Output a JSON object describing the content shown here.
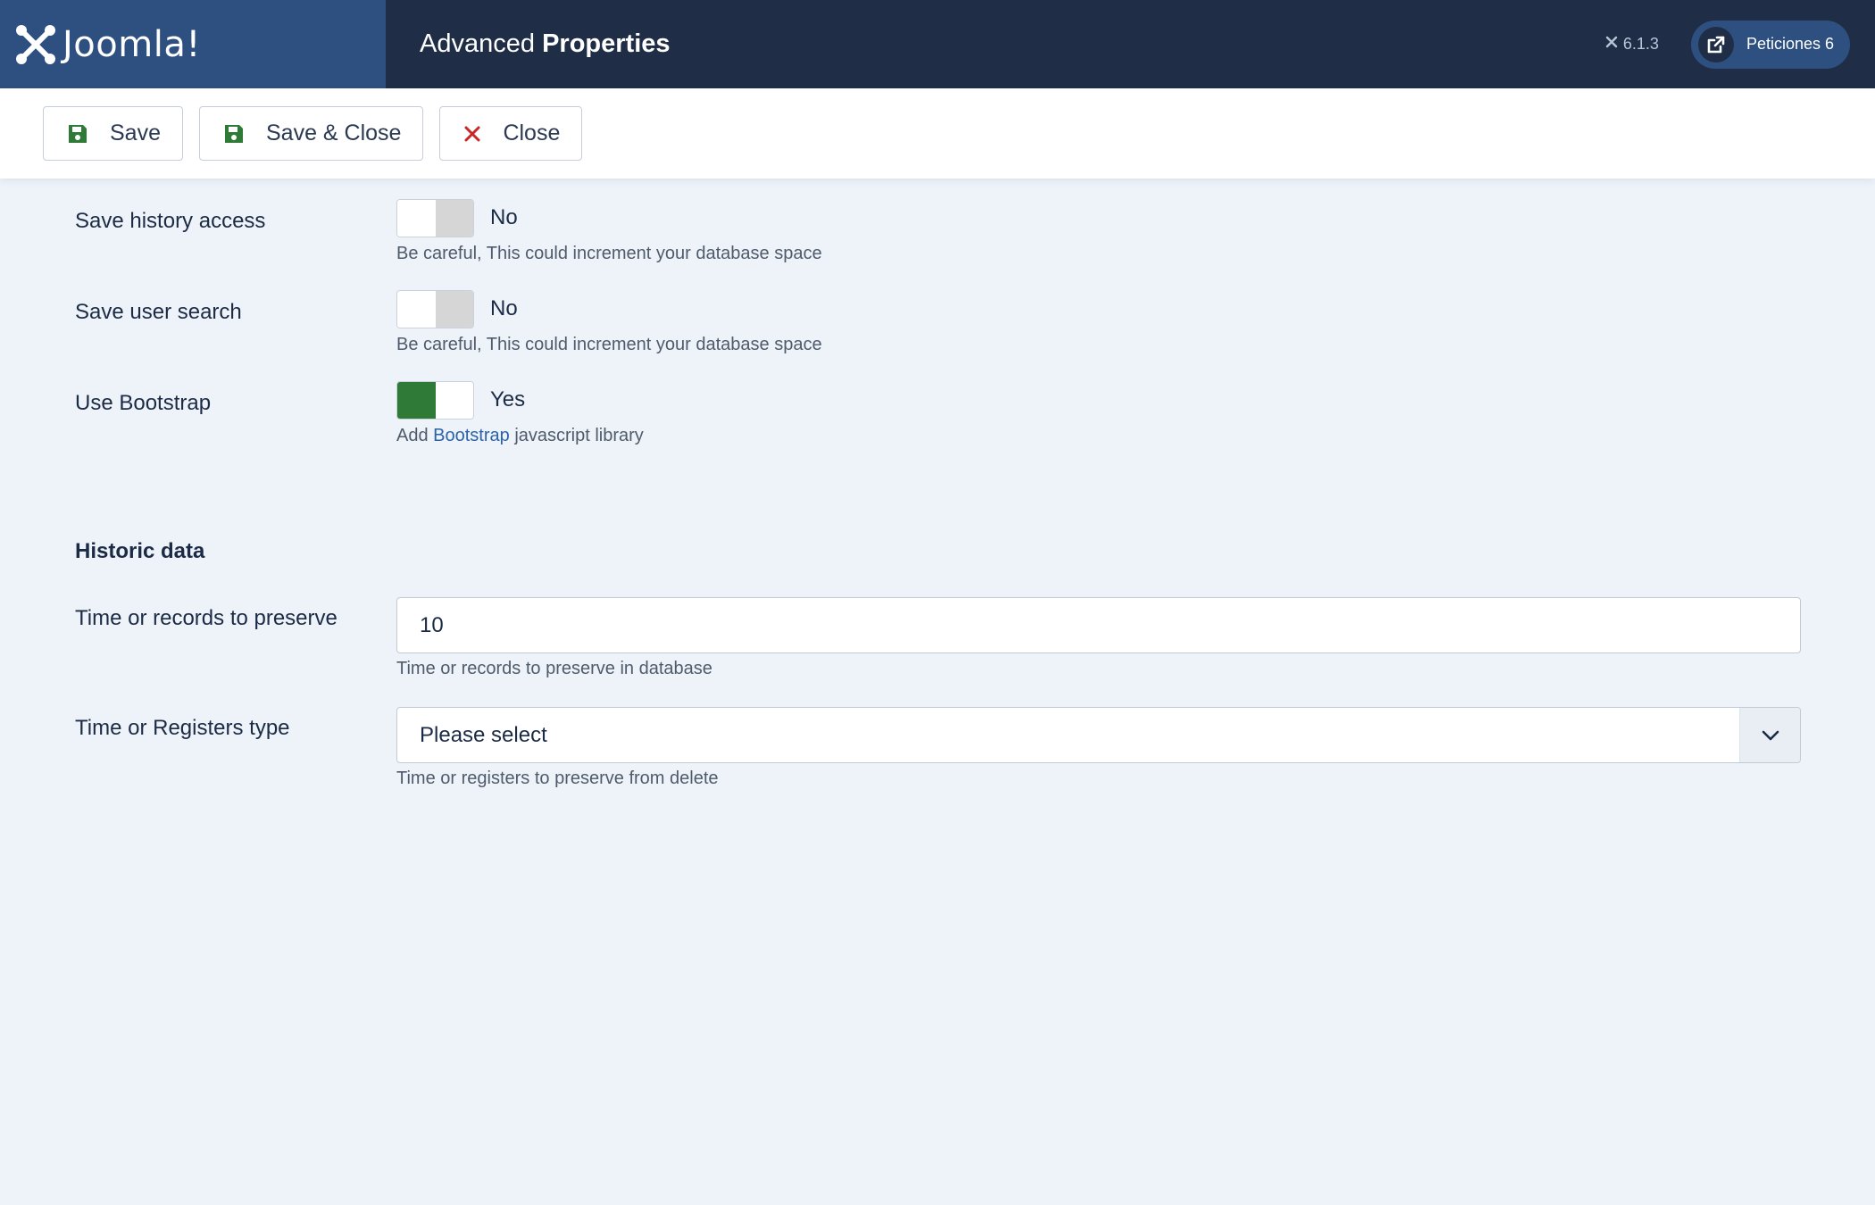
{
  "header": {
    "logo_text": "Joomla!",
    "title_light": "Advanced",
    "title_bold": "Properties",
    "version": "6.1.3",
    "requests_label": "Peticiones 6"
  },
  "toolbar": {
    "save_label": "Save",
    "save_close_label": "Save & Close",
    "close_label": "Close"
  },
  "form": {
    "save_history": {
      "label": "Save history access",
      "state": "No",
      "help": "Be careful, This could increment your database space"
    },
    "save_user_search": {
      "label": "Save user search",
      "state": "No",
      "help": "Be careful, This could increment your database space"
    },
    "use_bootstrap": {
      "label": "Use Bootstrap",
      "state": "Yes",
      "help_prefix": "Add",
      "help_link": "Bootstrap",
      "help_suffix": "javascript library"
    },
    "historic_section": "Historic data",
    "time_records": {
      "label": "Time or records to preserve",
      "value": "10",
      "help": "Time or records to preserve in database"
    },
    "registers_type": {
      "label": "Time or Registers type",
      "selected": "Please select",
      "help": "Time or registers to preserve from delete"
    }
  },
  "colors": {
    "header_bg": "#1f2e46",
    "logo_bg": "#2e5080",
    "toggle_on": "#2f7a36",
    "link": "#2a63a8",
    "page_bg": "#eef3fa"
  },
  "icons": {
    "logo": "joomla-logo-icon",
    "version": "joomla-small-icon",
    "requests": "external-link-icon",
    "save": "floppy-disk-icon",
    "close": "x-icon",
    "select": "chevron-down-icon"
  }
}
